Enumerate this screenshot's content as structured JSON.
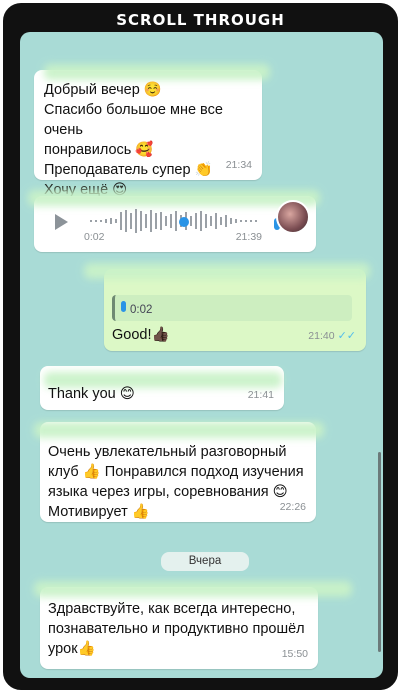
{
  "banner": {
    "title": "SCROLL THROUGH"
  },
  "messages": [
    {
      "id": "m1",
      "lines": [
        "Добрый вечер ☺️",
        "Спасибо большое мне все очень",
        "понравилось 🥰",
        "Преподаватель супер 👏",
        "Хочу ещё 😍"
      ],
      "time": "21:34"
    },
    {
      "id": "m2",
      "type": "voice",
      "duration": "0:02",
      "time": "21:39"
    },
    {
      "id": "m3",
      "quote_duration": "0:02",
      "text": "Good!👍🏿",
      "time": "21:40",
      "ticks": "✓✓"
    },
    {
      "id": "m4",
      "text": "Thank you 😊",
      "time": "21:41"
    },
    {
      "id": "m5",
      "lines": [
        "Очень увлекательный разговорный",
        "клуб 👍 Понравился подход изучения",
        "языка через игры, соревнования 😊",
        "Мотивирует 👍"
      ],
      "time": "22:26"
    },
    {
      "id": "m6",
      "lines": [
        "Здравствуйте,  как всегда интересно,",
        "познавательно и продуктивно прошёл",
        "урок👍"
      ],
      "time": "15:50"
    }
  ],
  "date_separator": "Вчера",
  "colors": {
    "chat_bg": "#a9dbd6",
    "incoming": "#ffffff",
    "outgoing": "#dcf8c6",
    "read_ticks": "#53bdeb"
  }
}
